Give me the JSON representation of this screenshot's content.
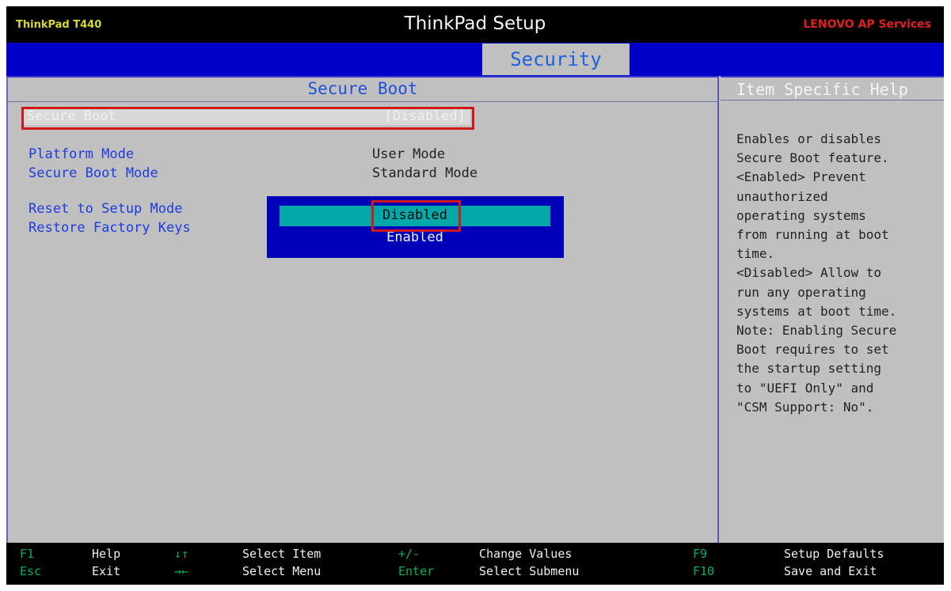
{
  "header": {
    "model": "ThinkPad T440",
    "title": "ThinkPad Setup",
    "vendor": "LENOVO AP Services"
  },
  "tabs": {
    "active": "Security"
  },
  "section": {
    "title": "Secure Boot"
  },
  "selected_row": {
    "label": "Secure Boot",
    "value": "[Disabled]"
  },
  "rows": [
    {
      "label": "Platform Mode",
      "value": "User Mode"
    },
    {
      "label": "Secure Boot Mode",
      "value": "Standard Mode"
    },
    {
      "label": "Reset to Setup Mode",
      "value": ""
    },
    {
      "label": "Restore Factory Keys",
      "value": ""
    }
  ],
  "popup": {
    "options": [
      "Disabled",
      "Enabled"
    ],
    "selected": "Disabled"
  },
  "help": {
    "title": "Item Specific Help",
    "text": "Enables or disables\nSecure Boot feature.\n<Enabled> Prevent\nunauthorized\noperating systems\nfrom running at boot\ntime.\n<Disabled> Allow to\nrun any operating\nsystems at boot time.\nNote: Enabling Secure\nBoot requires to set\nthe startup setting\nto \"UEFI Only\" and\n\"CSM Support: No\"."
  },
  "keybar": [
    {
      "key": "F1",
      "action": "Help"
    },
    {
      "key": "Esc",
      "action": "Exit"
    },
    {
      "key": "↓↑",
      "action": "Select Item"
    },
    {
      "key": "→←",
      "action": "Select Menu"
    },
    {
      "key": "+/-",
      "action": "Change Values"
    },
    {
      "key": "Enter",
      "action": "Select Submenu"
    },
    {
      "key": "F9",
      "action": "Setup Defaults"
    },
    {
      "key": "F10",
      "action": "Save and Exit"
    }
  ],
  "colors": {
    "background": "#c0c0c0",
    "tab_bar": "#0000c8",
    "label_blue": "#1c3ce0",
    "popup_bg": "#0000b8",
    "popup_highlight": "#00a8a8",
    "highlight_red": "#d01818",
    "key_green": "#00b060",
    "vendor_red": "#e02020",
    "model_yellow": "#d8d830"
  }
}
